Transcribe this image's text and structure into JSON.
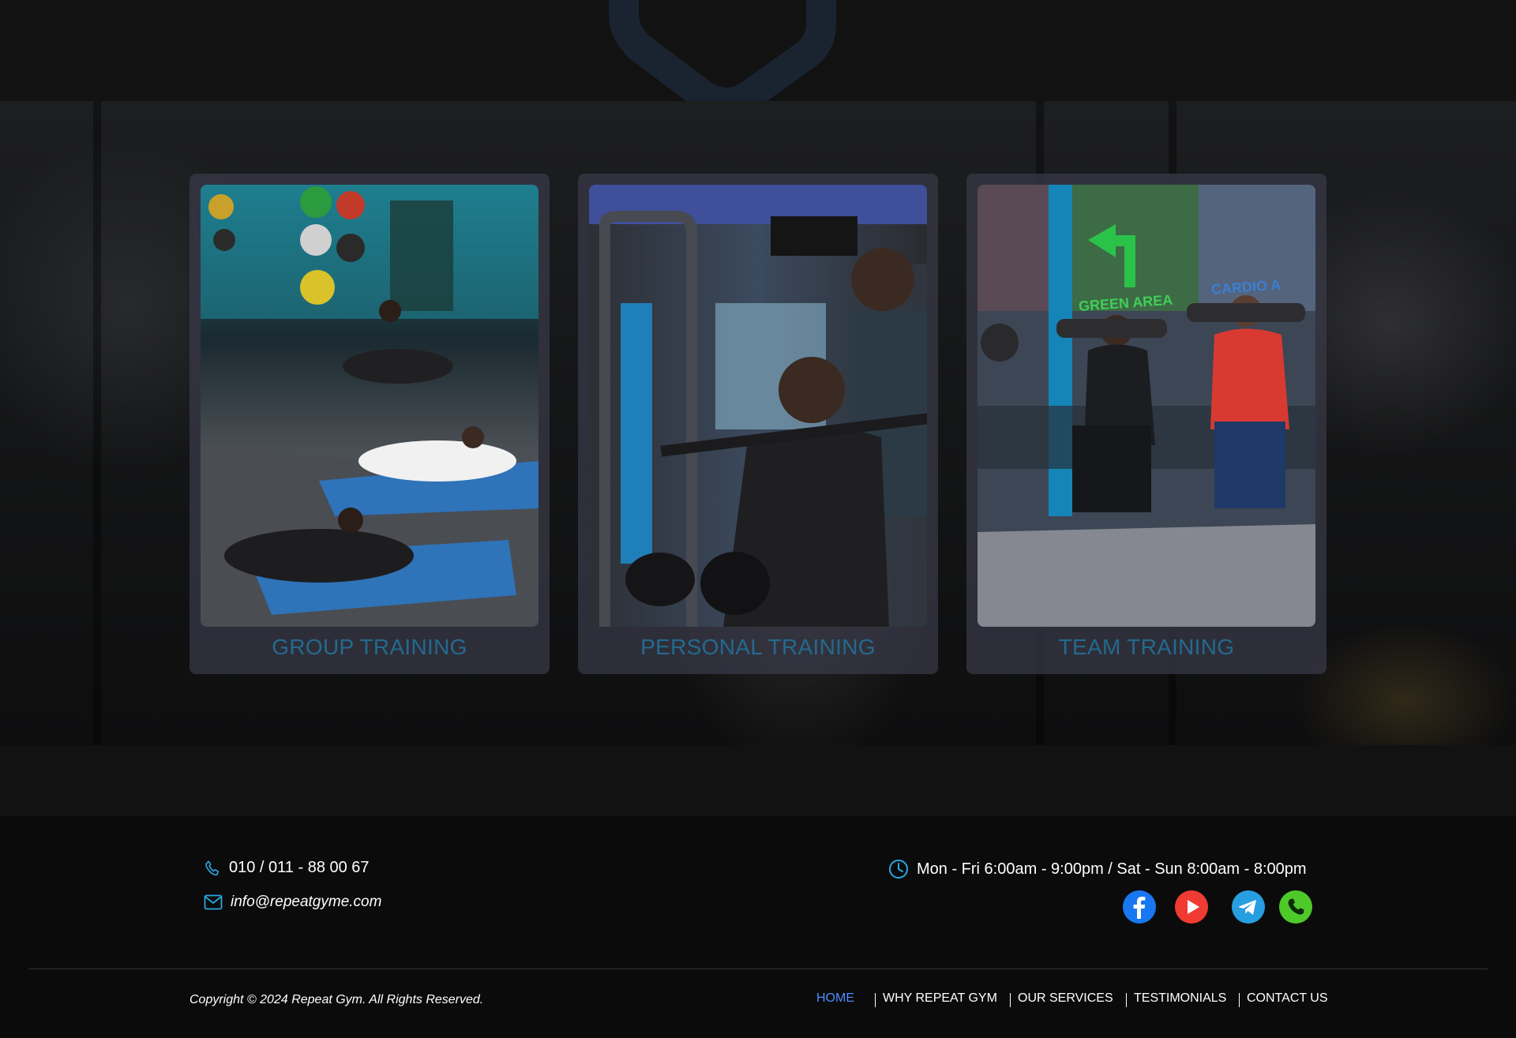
{
  "cards": [
    {
      "title": "GROUP TRAINING",
      "image": "group-training-photo"
    },
    {
      "title": "PERSONAL TRAINING",
      "image": "personal-training-photo"
    },
    {
      "title": "TEAM TRAINING",
      "image": "team-training-photo"
    }
  ],
  "footer": {
    "phone": "010 / 011 - 88 00 67",
    "email": "info@repeatgyme.com",
    "hours": "Mon - Fri 6:00am - 9:00pm / Sat - Sun 8:00am - 8:00pm",
    "socials": [
      {
        "icon": "facebook-icon",
        "color": "#1877f2"
      },
      {
        "icon": "youtube-icon",
        "color": "#f03b32"
      },
      {
        "icon": "telegram-icon",
        "color": "#279ee0"
      },
      {
        "icon": "whatsapp-icon",
        "color": "#4ec92a"
      }
    ],
    "copyright": "Copyright © 2024 Repeat Gym. All Rights Reserved.",
    "nav": [
      {
        "label": "HOME",
        "active": true
      },
      {
        "label": "WHY REPEAT GYM",
        "active": false
      },
      {
        "label": "OUR SERVICES",
        "active": false
      },
      {
        "label": "TESTIMONIALS",
        "active": false
      },
      {
        "label": "CONTACT US",
        "active": false
      }
    ]
  },
  "colors": {
    "accent": "#4a8cff",
    "card_title": "#236a8e",
    "icon_blue": "#29a7e1"
  }
}
